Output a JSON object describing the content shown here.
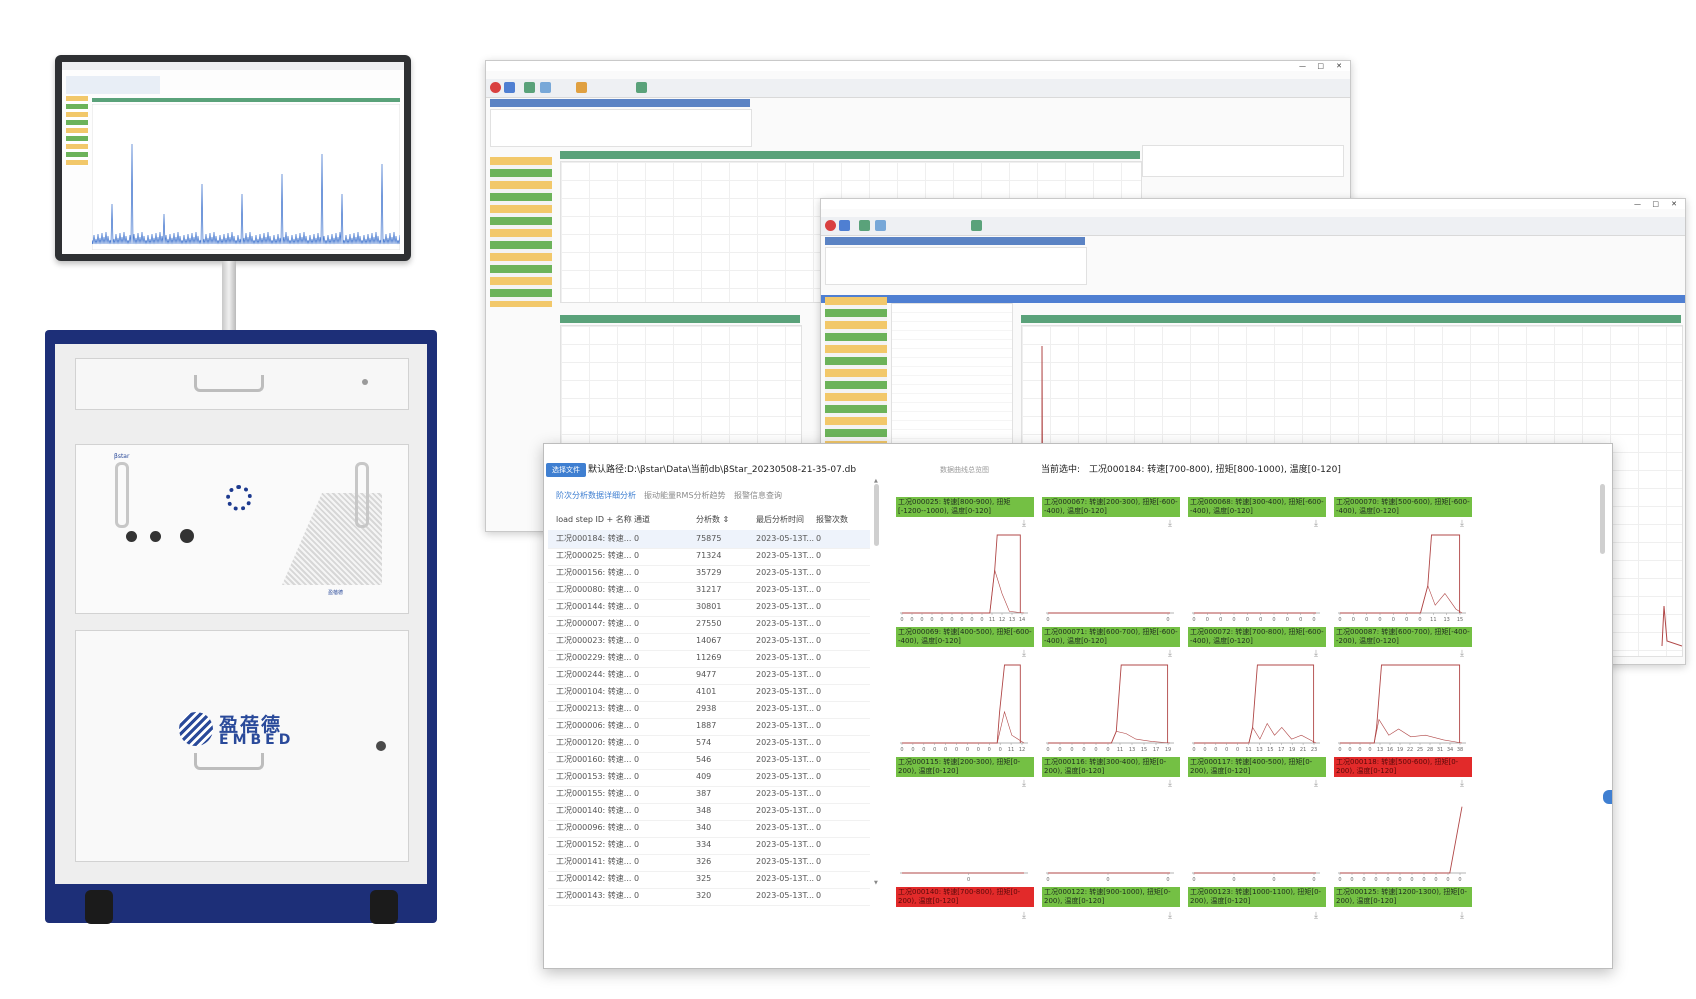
{
  "front_app": {
    "select_file_label": "选择文件",
    "db_path": "默认路径:D:\\βstar\\Data\\当前db\\βStar_20230508-21-35-07.db",
    "current_selection_label": "当前选中:",
    "current_selection_value": "工况000184: 转速[700-800), 扭矩[800-1000), 温度[0-120]",
    "tabs": [
      "阶次分析数据详细分析",
      "振动能量RMS分析趋势",
      "报警信息查询"
    ],
    "active_tab_index": 0,
    "overview_label": "数据曲线总览图",
    "table": {
      "headers": [
        "load step ID + 名称",
        "通道",
        "分析数 ⇕",
        "最后分析时间",
        "报警次数"
      ],
      "rows": [
        [
          "工况000184: 转速...",
          "0",
          "75875",
          "2023-05-13T...",
          "0"
        ],
        [
          "工况000025: 转速...",
          "0",
          "71324",
          "2023-05-13T...",
          "0"
        ],
        [
          "工况000156: 转速...",
          "0",
          "35729",
          "2023-05-13T...",
          "0"
        ],
        [
          "工况000080: 转速...",
          "0",
          "31217",
          "2023-05-13T...",
          "0"
        ],
        [
          "工况000144: 转速...",
          "0",
          "30801",
          "2023-05-13T...",
          "0"
        ],
        [
          "工况000007: 转速...",
          "0",
          "27550",
          "2023-05-13T...",
          "0"
        ],
        [
          "工况000023: 转速...",
          "0",
          "14067",
          "2023-05-13T...",
          "0"
        ],
        [
          "工况000229: 转速...",
          "0",
          "11269",
          "2023-05-13T...",
          "0"
        ],
        [
          "工况000244: 转速...",
          "0",
          "9477",
          "2023-05-13T...",
          "0"
        ],
        [
          "工况000104: 转速...",
          "0",
          "4101",
          "2023-05-13T...",
          "0"
        ],
        [
          "工况000213: 转速...",
          "0",
          "2938",
          "2023-05-13T...",
          "0"
        ],
        [
          "工况000006: 转速...",
          "0",
          "1887",
          "2023-05-13T...",
          "0"
        ],
        [
          "工况000120: 转速...",
          "0",
          "574",
          "2023-05-13T...",
          "0"
        ],
        [
          "工况000160: 转速...",
          "0",
          "546",
          "2023-05-13T...",
          "0"
        ],
        [
          "工况000153: 转速...",
          "0",
          "409",
          "2023-05-13T...",
          "0"
        ],
        [
          "工况000155: 转速...",
          "0",
          "387",
          "2023-05-13T...",
          "0"
        ],
        [
          "工况000140: 转速...",
          "0",
          "348",
          "2023-05-13T...",
          "0"
        ],
        [
          "工况000096: 转速...",
          "0",
          "340",
          "2023-05-13T...",
          "0"
        ],
        [
          "工况000152: 转速...",
          "0",
          "334",
          "2023-05-13T...",
          "0"
        ],
        [
          "工况000141: 转速...",
          "0",
          "326",
          "2023-05-13T...",
          "0"
        ],
        [
          "工况000142: 转速...",
          "0",
          "325",
          "2023-05-13T...",
          "0"
        ],
        [
          "工况000143: 转速...",
          "0",
          "320",
          "2023-05-13T...",
          "0"
        ]
      ],
      "selected_row_index": 0
    },
    "cards": [
      {
        "title": "工况000025: 转速[800-900), 扭矩[-1200--1000), 温度[0-120]",
        "status": "ok",
        "ticks": [
          "0",
          "0",
          "0",
          "0",
          "0",
          "0",
          "0",
          "0",
          "0",
          "11",
          "12",
          "13",
          "14"
        ],
        "profile": [
          [
            0,
            0
          ],
          [
            0.72,
            0
          ],
          [
            0.76,
            0.55
          ],
          [
            0.78,
            1
          ],
          [
            0.97,
            1
          ],
          [
            0.97,
            0
          ]
        ],
        "profile2": [
          [
            0.72,
            0
          ],
          [
            0.76,
            0.55
          ],
          [
            0.82,
            0.25
          ],
          [
            0.88,
            0.02
          ],
          [
            1,
            0
          ]
        ]
      },
      {
        "title": "工况000067: 转速[200-300), 扭矩[-600--400), 温度[0-120]",
        "status": "ok",
        "ticks": [
          "0",
          "0"
        ],
        "profile": [
          [
            0,
            0
          ],
          [
            1,
            0
          ]
        ],
        "profile2": []
      },
      {
        "title": "工况000068: 转速[300-400), 扭矩[-600--400), 温度[0-120]",
        "status": "ok",
        "ticks": [
          "0",
          "0",
          "0",
          "0",
          "0",
          "0",
          "0",
          "0",
          "0",
          "0"
        ],
        "profile": [
          [
            0,
            0
          ],
          [
            1,
            0
          ]
        ],
        "profile2": []
      },
      {
        "title": "工况000070: 转速[500-600), 扭矩[-600--400), 温度[0-120]",
        "status": "ok",
        "ticks": [
          "0",
          "0",
          "0",
          "0",
          "0",
          "0",
          "0",
          "11",
          "13",
          "15"
        ],
        "profile": [
          [
            0,
            0
          ],
          [
            0.66,
            0
          ],
          [
            0.72,
            0.35
          ],
          [
            0.75,
            1
          ],
          [
            0.98,
            1
          ],
          [
            0.98,
            0
          ]
        ],
        "profile2": [
          [
            0.66,
            0
          ],
          [
            0.72,
            0.35
          ],
          [
            0.78,
            0.1
          ],
          [
            0.86,
            0.25
          ],
          [
            0.95,
            0.05
          ],
          [
            1,
            0
          ]
        ]
      },
      {
        "title": "工况000069: 转速[400-500), 扭矩[-600--400), 温度[0-120]",
        "status": "ok",
        "ticks": [
          "0",
          "0",
          "0",
          "0",
          "0",
          "0",
          "0",
          "0",
          "0",
          "0",
          "11",
          "12"
        ],
        "profile": [
          [
            0,
            0
          ],
          [
            0.78,
            0
          ],
          [
            0.8,
            0.4
          ],
          [
            0.84,
            1
          ],
          [
            0.97,
            1
          ],
          [
            0.97,
            0
          ]
        ],
        "profile2": [
          [
            0.78,
            0
          ],
          [
            0.84,
            0.4
          ],
          [
            0.9,
            0.1
          ],
          [
            1,
            0
          ]
        ]
      },
      {
        "title": "工况000071: 转速[600-700), 扭矩[-600--400), 温度[0-120]",
        "status": "ok",
        "ticks": [
          "0",
          "0",
          "0",
          "0",
          "0",
          "0",
          "11",
          "13",
          "15",
          "17",
          "19"
        ],
        "profile": [
          [
            0,
            0
          ],
          [
            0.52,
            0
          ],
          [
            0.56,
            0.15
          ],
          [
            0.6,
            1
          ],
          [
            0.98,
            1
          ],
          [
            0.98,
            0
          ]
        ],
        "profile2": [
          [
            0.52,
            0
          ],
          [
            0.56,
            0.15
          ],
          [
            0.64,
            0.12
          ],
          [
            0.72,
            0.05
          ],
          [
            0.85,
            0.02
          ],
          [
            1,
            0
          ]
        ]
      },
      {
        "title": "工况000072: 转速[700-800), 扭矩[-600--400), 温度[0-120]",
        "status": "ok",
        "ticks": [
          "0",
          "0",
          "0",
          "0",
          "0",
          "11",
          "13",
          "15",
          "17",
          "19",
          "21",
          "23"
        ],
        "profile": [
          [
            0,
            0
          ],
          [
            0.45,
            0
          ],
          [
            0.48,
            0.2
          ],
          [
            0.52,
            1
          ],
          [
            0.98,
            1
          ],
          [
            0.98,
            0
          ]
        ],
        "profile2": [
          [
            0.45,
            0
          ],
          [
            0.48,
            0.2
          ],
          [
            0.54,
            0.05
          ],
          [
            0.6,
            0.25
          ],
          [
            0.66,
            0.1
          ],
          [
            0.72,
            0.2
          ],
          [
            0.8,
            0.05
          ],
          [
            0.88,
            0.1
          ],
          [
            1,
            0
          ]
        ]
      },
      {
        "title": "工况000087: 转速[600-700), 扭矩[-400--200), 温度[0-120]",
        "status": "ok",
        "ticks": [
          "0",
          "0",
          "0",
          "0",
          "13",
          "16",
          "19",
          "22",
          "25",
          "28",
          "31",
          "34",
          "38"
        ],
        "profile": [
          [
            0,
            0
          ],
          [
            0.28,
            0
          ],
          [
            0.3,
            0.2
          ],
          [
            0.34,
            1
          ],
          [
            0.98,
            1
          ],
          [
            0.98,
            0
          ]
        ],
        "profile2": [
          [
            0.28,
            0
          ],
          [
            0.32,
            0.3
          ],
          [
            0.4,
            0.1
          ],
          [
            0.48,
            0.18
          ],
          [
            0.58,
            0.08
          ],
          [
            0.7,
            0.1
          ],
          [
            0.85,
            0.04
          ],
          [
            1,
            0
          ]
        ]
      },
      {
        "title": "工况000115: 转速[200-300), 扭矩[0-200), 温度[0-120]",
        "status": "ok",
        "ticks": [
          "0"
        ],
        "profile": [
          [
            0,
            0
          ],
          [
            1,
            0
          ]
        ],
        "profile2": []
      },
      {
        "title": "工况000116: 转速[300-400), 扭矩[0-200), 温度[0-120]",
        "status": "ok",
        "ticks": [
          "0",
          "0",
          "0"
        ],
        "profile": [
          [
            0,
            0
          ],
          [
            1,
            0
          ]
        ],
        "profile2": []
      },
      {
        "title": "工况000117: 转速[400-500), 扭矩[0-200), 温度[0-120]",
        "status": "ok",
        "ticks": [
          "0",
          "0",
          "0",
          "0"
        ],
        "profile": [
          [
            0,
            0
          ],
          [
            1,
            0
          ]
        ],
        "profile2": []
      },
      {
        "title": "工况000118: 转速[500-600), 扭矩[0-200), 温度[0-120]",
        "status": "bad",
        "ticks": [
          "0",
          "0",
          "0",
          "0",
          "0",
          "0",
          "0",
          "0",
          "0",
          "0",
          "0"
        ],
        "profile": [
          [
            0,
            0
          ],
          [
            0.9,
            0
          ],
          [
            1,
            0.85
          ]
        ],
        "profile2": []
      },
      {
        "title": "工况000140: 转速[700-800), 扭矩[0-200), 温度[0-120]",
        "status": "bad",
        "ticks": [],
        "profile": [],
        "profile2": []
      },
      {
        "title": "工况000122: 转速[900-1000), 扭矩[0-200), 温度[0-120]",
        "status": "ok",
        "ticks": [],
        "profile": [],
        "profile2": []
      },
      {
        "title": "工况000123: 转速[1000-1100), 扭矩[0-200), 温度[0-120]",
        "status": "ok",
        "ticks": [],
        "profile": [],
        "profile2": []
      },
      {
        "title": "工况000125: 转速[1200-1300), 扭矩[0-200), 温度[0-120]",
        "status": "ok",
        "ticks": [],
        "profile": [],
        "profile2": []
      }
    ]
  },
  "cabinet": {
    "logo_cn": "盈蓓德",
    "logo_en": "EMBED",
    "panel_brand": "βstar"
  },
  "colors": {
    "ok_header": "#74c044",
    "bad_header": "#e22a2a",
    "cabinet_blue": "#1d2f78",
    "accent_blue": "#3f7fd1",
    "chart_line": "#b04747"
  },
  "icons": [
    "download-icon",
    "sort-icon"
  ]
}
